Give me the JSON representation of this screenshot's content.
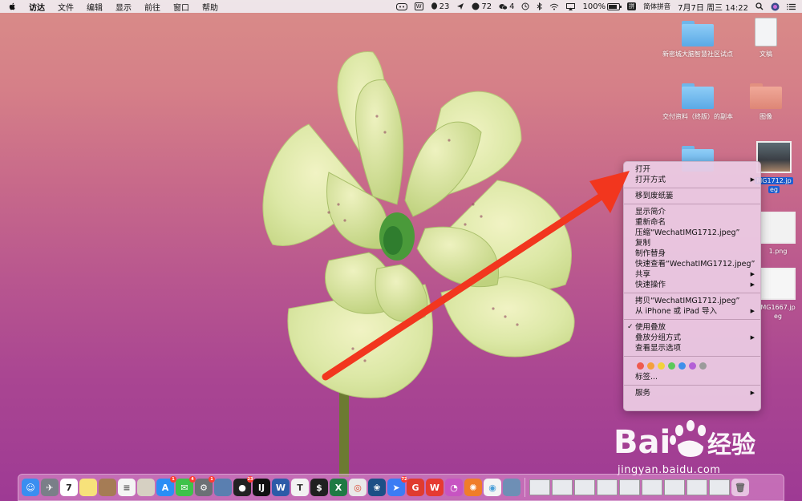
{
  "menubar": {
    "app_name": "访达",
    "menus": [
      "文件",
      "编辑",
      "显示",
      "前往",
      "窗口",
      "帮助"
    ],
    "status": {
      "qq_count": "23",
      "weibo_count": "72",
      "wechat_count": "4",
      "battery": "100%",
      "input_method": "简体拼音",
      "datetime": "7月7日 周三  14:22"
    }
  },
  "desktop_icons": [
    {
      "label": "新密城大脑智慧社区试点",
      "kind": "folder"
    },
    {
      "label": "文稿",
      "kind": "document"
    },
    {
      "label": "交付资料（终版）的副本",
      "kind": "folder"
    },
    {
      "label": "图像",
      "kind": "folder-salmon"
    },
    {
      "label": "",
      "kind": "folder"
    },
    {
      "label": "MG1712.jp",
      "label2": "eg",
      "kind": "image-selected"
    },
    {
      "label": "1.png",
      "kind": "image"
    },
    {
      "label": "MG1667.jp",
      "label2": "eg",
      "kind": "image"
    }
  ],
  "context_menu": {
    "items": [
      {
        "label": "打开",
        "submenu": false
      },
      {
        "label": "打开方式",
        "submenu": true
      },
      {
        "separator": true
      },
      {
        "label": "移到废纸篓",
        "submenu": false
      },
      {
        "separator": true
      },
      {
        "label": "显示简介",
        "submenu": false
      },
      {
        "label": "重新命名",
        "submenu": false
      },
      {
        "label": "压缩“WechatIMG1712.jpeg”",
        "submenu": false
      },
      {
        "label": "复制",
        "submenu": false
      },
      {
        "label": "制作替身",
        "submenu": false
      },
      {
        "label": "快速查看“WechatIMG1712.jpeg”",
        "submenu": false
      },
      {
        "label": "共享",
        "submenu": true
      },
      {
        "label": "快速操作",
        "submenu": true
      },
      {
        "separator": true
      },
      {
        "label": "拷贝“WechatIMG1712.jpeg”",
        "submenu": false
      },
      {
        "label": "从 iPhone 或 iPad 导入",
        "submenu": true
      },
      {
        "separator": true
      },
      {
        "label": "使用叠放",
        "submenu": false,
        "checked": true
      },
      {
        "label": "叠放分组方式",
        "submenu": true
      },
      {
        "label": "查看显示选项",
        "submenu": false
      },
      {
        "separator": true
      },
      {
        "tags": [
          "#ef5a4f",
          "#f4a03b",
          "#f2d23c",
          "#5cc95a",
          "#3f8fea",
          "#b45fd6",
          "#9b9b9b"
        ]
      },
      {
        "label": "标签...",
        "submenu": false
      },
      {
        "separator": true
      },
      {
        "label": "服务",
        "submenu": true
      }
    ]
  },
  "dock": {
    "apps": [
      {
        "name": "finder-app-icon",
        "color": "#3a8ef0",
        "glyph": "☺"
      },
      {
        "name": "launchpad-app-icon",
        "color": "#7a7f88",
        "glyph": "✈"
      },
      {
        "name": "calendar-app-icon",
        "color": "#ffffff",
        "glyph": "7",
        "text_color": "#222"
      },
      {
        "name": "notes-app-icon",
        "color": "#f7e27a",
        "glyph": ""
      },
      {
        "name": "contacts-app-icon",
        "color": "#a57c55",
        "glyph": ""
      },
      {
        "name": "reminders-app-icon",
        "color": "#f4f4f4",
        "glyph": "≡",
        "text_color": "#555"
      },
      {
        "name": "preview-app-icon",
        "color": "#d6d0c2",
        "glyph": ""
      },
      {
        "name": "appstore-app-icon",
        "color": "#2b8ef5",
        "glyph": "A",
        "badge": "1"
      },
      {
        "name": "wechat-app-icon",
        "color": "#3ec24a",
        "glyph": "✉",
        "badge": "4"
      },
      {
        "name": "settings-app-icon",
        "color": "#6c7075",
        "glyph": "⚙",
        "badge": "1"
      },
      {
        "name": "photo-app-icon",
        "color": "#5a7fb0",
        "glyph": ""
      },
      {
        "name": "qq-app-icon",
        "color": "#222222",
        "glyph": "●",
        "badge": "23"
      },
      {
        "name": "intellij-app-icon",
        "color": "#111111",
        "glyph": "IJ"
      },
      {
        "name": "word-app-icon",
        "color": "#2d5ba8",
        "glyph": "W"
      },
      {
        "name": "typora-app-icon",
        "color": "#f2f2f2",
        "glyph": "T",
        "text_color": "#333"
      },
      {
        "name": "terminal-app-icon",
        "color": "#202020",
        "glyph": "$"
      },
      {
        "name": "excel-app-icon",
        "color": "#1f7a44",
        "glyph": "X"
      },
      {
        "name": "chrome-app-icon",
        "color": "#e9e9e9",
        "glyph": "◎",
        "text_color": "#d9442c"
      },
      {
        "name": "sourcetree-app-icon",
        "color": "#1c4f86",
        "glyph": "❀"
      },
      {
        "name": "feishu-app-icon",
        "color": "#3b7cf4",
        "glyph": "➤",
        "badge": "72"
      },
      {
        "name": "app-red-icon",
        "color": "#e03b2f",
        "glyph": "G"
      },
      {
        "name": "wps-app-icon",
        "color": "#e63a32",
        "glyph": "W"
      },
      {
        "name": "colorful-app-icon",
        "color": "#c754c2",
        "glyph": "◔"
      },
      {
        "name": "orange-app-icon",
        "color": "#f07d2a",
        "glyph": "✺"
      },
      {
        "name": "bilibili-app-icon",
        "color": "#f4f4f4",
        "glyph": "◉",
        "text_color": "#4a9fd8"
      },
      {
        "name": "screenshot-app-icon",
        "color": "#6e8fb5",
        "glyph": ""
      }
    ],
    "right_items": 9
  },
  "watermark": {
    "brand": "Baidu经验",
    "url": "jingyan.baidu.com"
  }
}
